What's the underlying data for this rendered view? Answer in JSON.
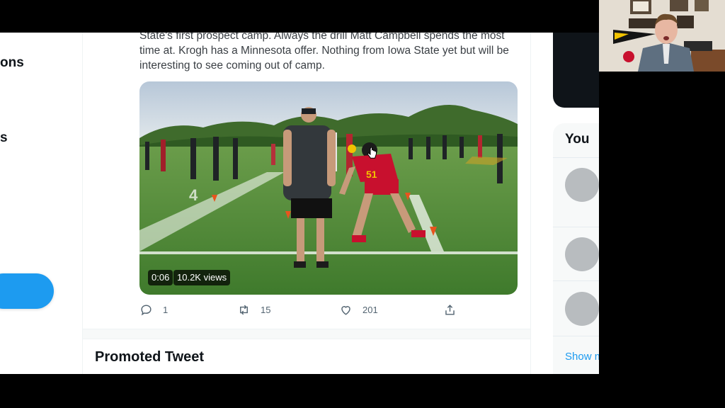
{
  "nav": {
    "item_a_fragment": "ons",
    "item_b_fragment": "s"
  },
  "tweet": {
    "text": "State's first prospect camp. Always the drill Matt Campbell spends the most time at. Krogh has a Minnesota offer. Nothing from Iowa State yet but will be interesting to see coming out of camp.",
    "video": {
      "timestamp": "0:06",
      "views": "10.2K views"
    },
    "actions": {
      "replies": "1",
      "retweets": "15",
      "likes": "201"
    }
  },
  "promoted": {
    "title": "Promoted Tweet"
  },
  "sidebar": {
    "who_to_follow_title": "You",
    "show_more": "Show m"
  },
  "icons": [
    "reply-icon",
    "retweet-icon",
    "like-icon",
    "share-icon",
    "cursor-icon"
  ],
  "colors": {
    "accent": "#1d9bf0",
    "field": "#4f8a3a",
    "jersey": "#c8102e"
  }
}
